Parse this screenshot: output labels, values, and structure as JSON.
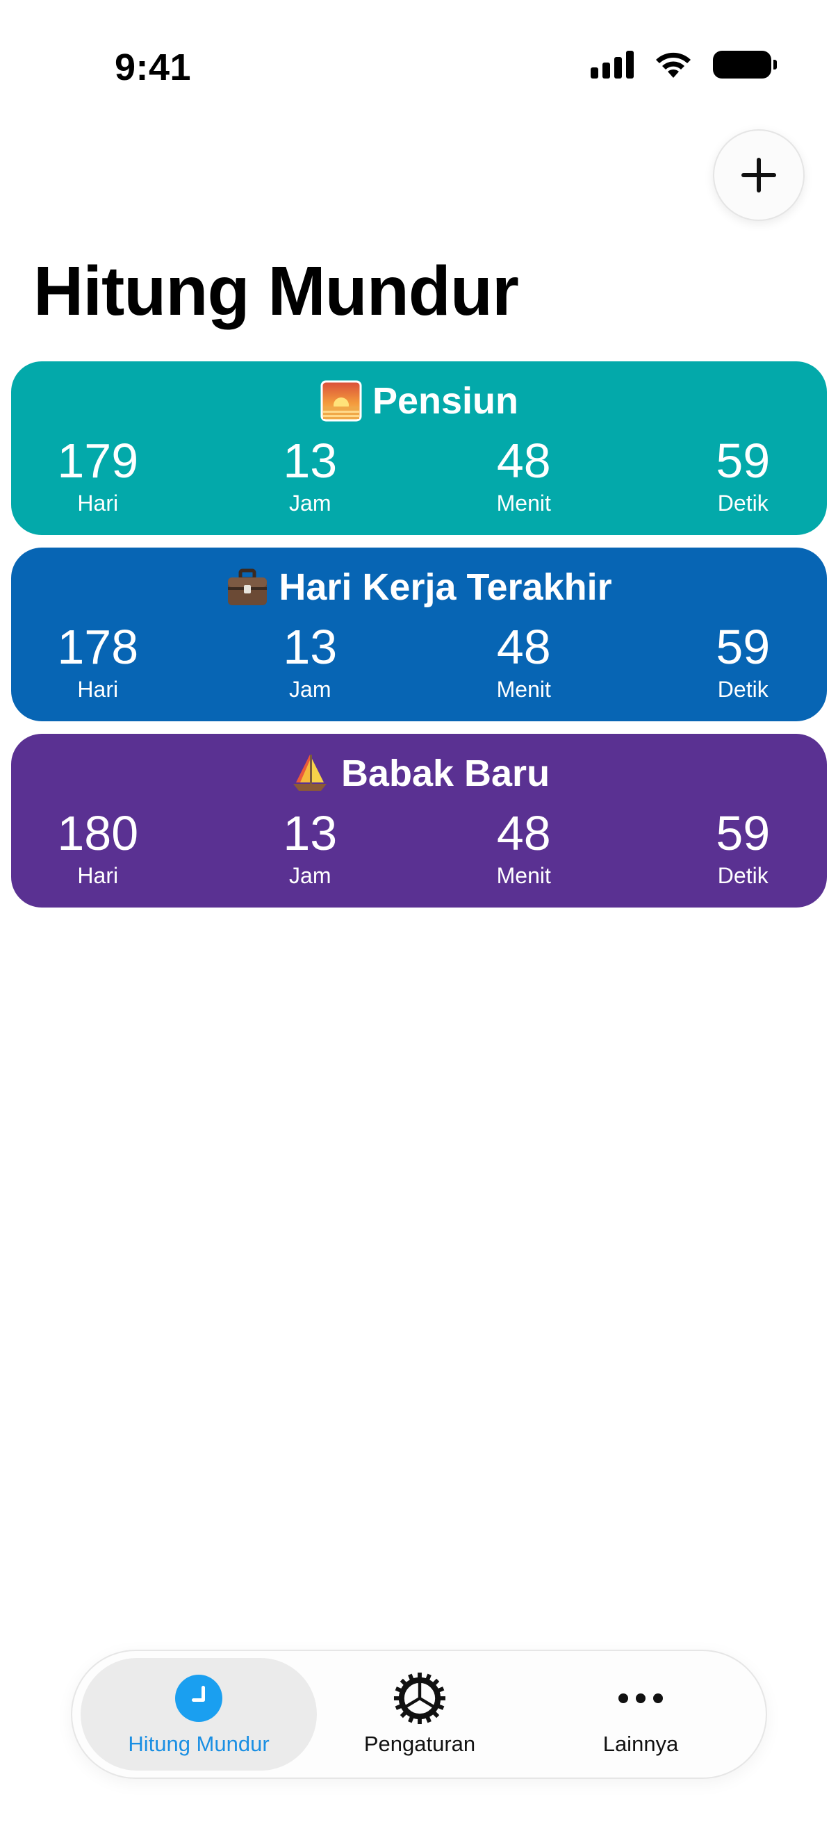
{
  "status_bar": {
    "time": "9:41"
  },
  "header": {
    "title": "Hitung Mundur",
    "add_icon": "plus-icon"
  },
  "countdowns": [
    {
      "emoji": "sunrise",
      "title": "Pensiun",
      "color": "#03A9AA",
      "days": "179",
      "hours": "13",
      "minutes": "48",
      "seconds": "59",
      "labels": {
        "days": "Hari",
        "hours": "Jam",
        "minutes": "Menit",
        "seconds": "Detik"
      }
    },
    {
      "emoji": "briefcase",
      "title": "Hari Kerja Terakhir",
      "color": "#0765B4",
      "days": "178",
      "hours": "13",
      "minutes": "48",
      "seconds": "59",
      "labels": {
        "days": "Hari",
        "hours": "Jam",
        "minutes": "Menit",
        "seconds": "Detik"
      }
    },
    {
      "emoji": "sailboat",
      "title": "Babak Baru",
      "color": "#5A3192",
      "days": "180",
      "hours": "13",
      "minutes": "48",
      "seconds": "59",
      "labels": {
        "days": "Hari",
        "hours": "Jam",
        "minutes": "Menit",
        "seconds": "Detik"
      }
    }
  ],
  "tab_bar": {
    "tabs": [
      {
        "label": "Hitung Mundur",
        "icon": "clock-icon",
        "active": true
      },
      {
        "label": "Pengaturan",
        "icon": "gear-icon",
        "active": false
      },
      {
        "label": "Lainnya",
        "icon": "more-icon",
        "active": false
      }
    ],
    "accent": "#1A8FE3"
  }
}
